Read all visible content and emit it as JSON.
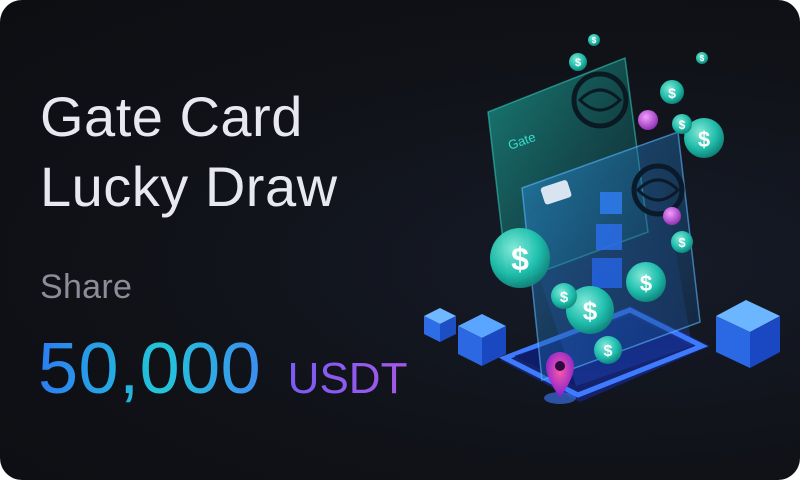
{
  "banner": {
    "title_line1": "Gate Card",
    "title_line2": "Lucky Draw",
    "share_label": "Share",
    "amount": "50,000",
    "unit": "USDT"
  },
  "illustration": {
    "coin_symbol": "$",
    "card_brand": "Gate"
  },
  "colors": {
    "background": "#101218",
    "title": "#e7e8f0",
    "share_label": "#8c8d98",
    "amount_gradient_start": "#2c7df2",
    "amount_gradient_end": "#22c6d8",
    "unit_gradient_start": "#7b5cf5",
    "unit_gradient_end": "#a358e8",
    "accent_cyan": "#1fd6c4",
    "accent_blue": "#2f6cff"
  }
}
